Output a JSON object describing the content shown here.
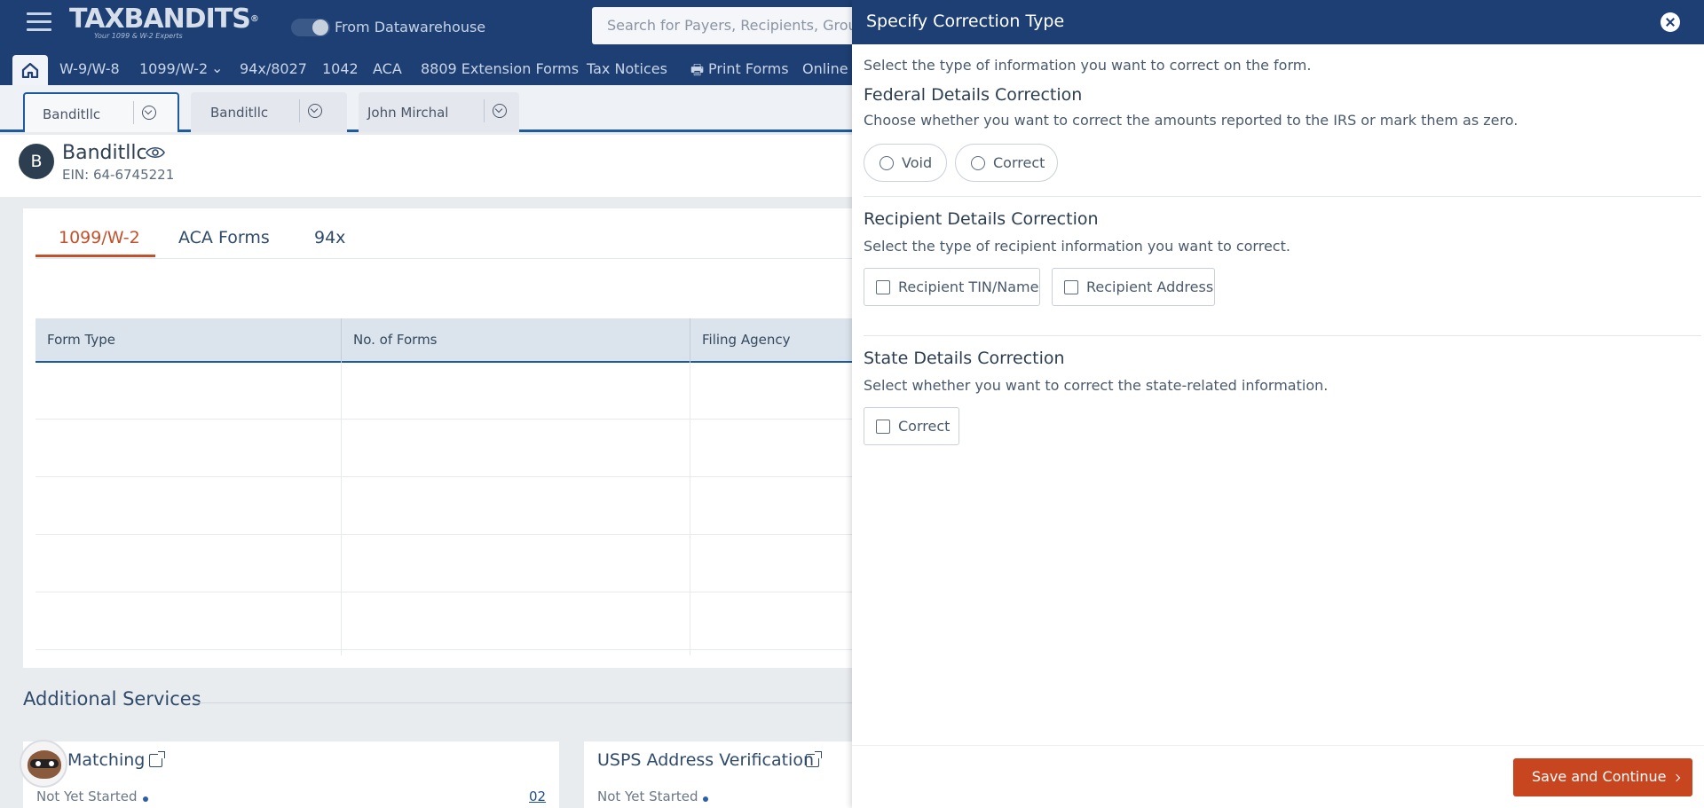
{
  "app": {
    "logo_text": "TAXBANDITS",
    "logo_tagline": "Your 1099 & W-2 Experts",
    "datawarehouse_label": "From Datawarehouse",
    "search_placeholder": "Search for Payers, Recipients, Groups"
  },
  "nav": {
    "items": [
      "W-9/W-8",
      "1099/W-2",
      "94x/8027",
      "1042",
      "ACA",
      "8809 Extension Forms",
      "Tax Notices",
      "Print Forms",
      "Online A"
    ]
  },
  "payer_tabs": [
    {
      "label": "Banditllc"
    },
    {
      "label": "Banditllc"
    },
    {
      "label": "John Mirchal"
    }
  ],
  "payer": {
    "avatar_letter": "B",
    "name": "Banditllc",
    "ein": "EIN: 64-6745221"
  },
  "form_tabs": [
    "1099/W-2",
    "ACA Forms",
    "94x"
  ],
  "table": {
    "headers": [
      "Form Type",
      "No. of Forms",
      "Filing Agency"
    ]
  },
  "additional_services": {
    "title": "Additional Services",
    "cards": [
      {
        "title": "Matching",
        "status": "Not Yet Started",
        "count": "02"
      },
      {
        "title": "USPS Address Verification",
        "status": "Not Yet Started"
      }
    ]
  },
  "drawer": {
    "title": "Specify Correction Type",
    "intro": "Select the type of information you want to correct on the form.",
    "federal": {
      "heading": "Federal Details Correction",
      "description": "Choose whether you want to correct the amounts reported to the IRS or mark them as zero.",
      "options": [
        "Void",
        "Correct"
      ]
    },
    "recipient": {
      "heading": "Recipient Details Correction",
      "description": "Select the type of recipient information you want to correct.",
      "options": [
        "Recipient TIN/Name",
        "Recipient Address"
      ]
    },
    "state": {
      "heading": "State Details Correction",
      "description": "Select whether you want to correct the state-related information.",
      "options": [
        "Correct"
      ]
    },
    "save_label": "Save and Continue"
  },
  "colors": {
    "header_navy": "#1d3f73",
    "accent_orange": "#c8461f",
    "tab_active": "#c2502b"
  }
}
